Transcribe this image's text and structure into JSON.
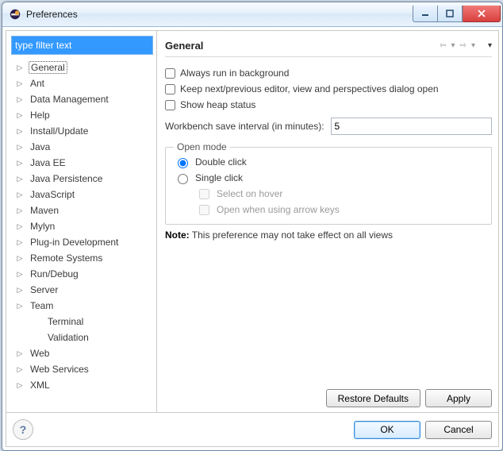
{
  "window": {
    "title": "Preferences"
  },
  "filter": {
    "placeholder": "type filter text"
  },
  "tree": {
    "items": [
      {
        "label": "General",
        "expandable": true,
        "selected": true
      },
      {
        "label": "Ant",
        "expandable": true
      },
      {
        "label": "Data Management",
        "expandable": true
      },
      {
        "label": "Help",
        "expandable": true
      },
      {
        "label": "Install/Update",
        "expandable": true
      },
      {
        "label": "Java",
        "expandable": true
      },
      {
        "label": "Java EE",
        "expandable": true
      },
      {
        "label": "Java Persistence",
        "expandable": true
      },
      {
        "label": "JavaScript",
        "expandable": true
      },
      {
        "label": "Maven",
        "expandable": true
      },
      {
        "label": "Mylyn",
        "expandable": true
      },
      {
        "label": "Plug-in Development",
        "expandable": true
      },
      {
        "label": "Remote Systems",
        "expandable": true
      },
      {
        "label": "Run/Debug",
        "expandable": true
      },
      {
        "label": "Server",
        "expandable": true
      },
      {
        "label": "Team",
        "expandable": true
      },
      {
        "label": "Terminal",
        "expandable": false
      },
      {
        "label": "Validation",
        "expandable": false
      },
      {
        "label": "Web",
        "expandable": true
      },
      {
        "label": "Web Services",
        "expandable": true
      },
      {
        "label": "XML",
        "expandable": true
      }
    ]
  },
  "page": {
    "heading": "General",
    "chk_background": "Always run in background",
    "chk_keep_dialog": "Keep next/previous editor, view and perspectives dialog open",
    "chk_heap": "Show heap status",
    "save_interval_label": "Workbench save interval (in minutes):",
    "save_interval_value": "5",
    "open_mode": {
      "legend": "Open mode",
      "double": "Double click",
      "single": "Single click",
      "hover": "Select on hover",
      "arrows": "Open when using arrow keys"
    },
    "note_label": "Note:",
    "note_text": " This preference may not take effect on all views"
  },
  "buttons": {
    "restore": "Restore Defaults",
    "apply": "Apply",
    "ok": "OK",
    "cancel": "Cancel"
  }
}
